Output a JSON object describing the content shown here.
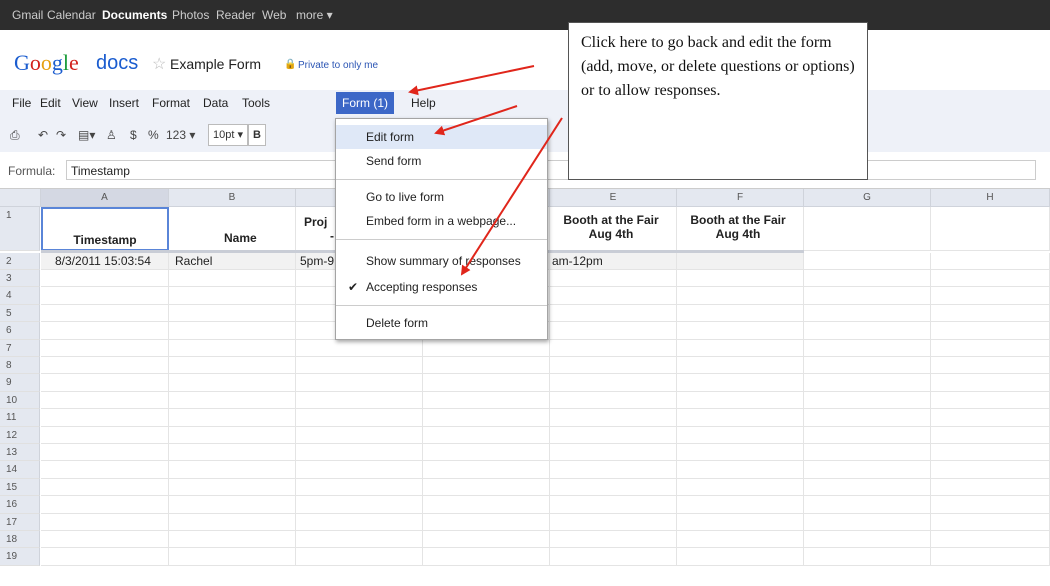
{
  "topbar": {
    "links": [
      "Gmail",
      "Calendar",
      "Documents",
      "Photos",
      "Reader",
      "Web",
      "more ▾"
    ],
    "active": "Documents"
  },
  "title": {
    "app": "docs",
    "doc_name": "Example Form",
    "privacy": "Private to only me"
  },
  "menubar": {
    "items": [
      "File",
      "Edit",
      "View",
      "Insert",
      "Format",
      "Data",
      "Tools",
      "Form (1)",
      "Help"
    ]
  },
  "toolbar": {
    "currency": "$",
    "percent": "%",
    "number_format": "123 ▾",
    "font_size": "10pt ▾",
    "bold": "B"
  },
  "formula": {
    "label": "Formula:",
    "value": "Timestamp"
  },
  "grid": {
    "columns": [
      "A",
      "B",
      "C",
      "D",
      "E",
      "F",
      "G",
      "H"
    ],
    "header_row": [
      "Timestamp",
      "Name",
      "Proj",
      "",
      "Booth at the Fair Aug 4th",
      "Booth at the Fair Aug 4th",
      "",
      ""
    ],
    "header_row_c_line2": "-",
    "data_row": [
      "8/3/2011 15:03:54",
      "Rachel",
      "5pm-9",
      "",
      "am-12pm",
      "",
      "",
      ""
    ],
    "row_numbers": [
      "1",
      "2",
      "3",
      "4",
      "5",
      "6",
      "7",
      "8",
      "9",
      "10",
      "11",
      "12",
      "13",
      "14",
      "15",
      "16",
      "17",
      "18",
      "19"
    ]
  },
  "form_menu": {
    "items": [
      {
        "label": "Edit form",
        "highlighted": true
      },
      {
        "label": "Send form"
      },
      {
        "label": "Go to live form"
      },
      {
        "label": "Embed form in a webpage..."
      },
      {
        "label": "Show summary of responses"
      },
      {
        "label": "Accepting responses",
        "checked": true
      },
      {
        "label": "Delete form"
      }
    ],
    "check_glyph": "✔"
  },
  "callout": {
    "text": "Click here to go back and edit the form (add, move, or delete questions or options) or to allow responses."
  },
  "colors": {
    "menu_open": "#3c67c7",
    "arrow": "#e0261b",
    "topbar": "#2d2d2d"
  }
}
